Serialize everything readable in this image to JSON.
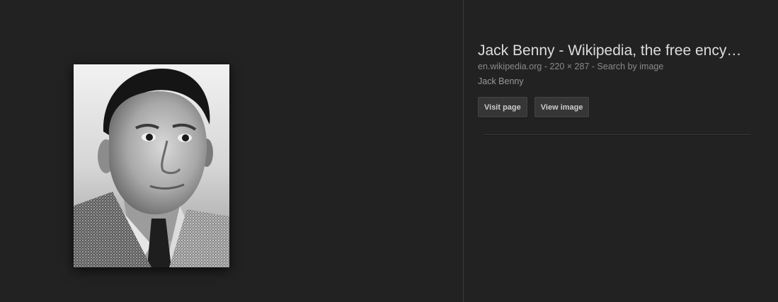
{
  "result": {
    "title": "Jack Benny - Wikipedia, the free ency…",
    "domain": "en.wikipedia.org",
    "separator": " - ",
    "dimensions": "220 × 287",
    "search_by_image": "Search by image",
    "description": "Jack Benny"
  },
  "actions": {
    "visit_page": "Visit page",
    "view_image": "View image"
  },
  "preview": {
    "image_alt": "Jack Benny"
  },
  "colors": {
    "background": "#222222",
    "title": "#dddddd",
    "meta": "#8a8a8a",
    "button_bg": "#363636"
  }
}
